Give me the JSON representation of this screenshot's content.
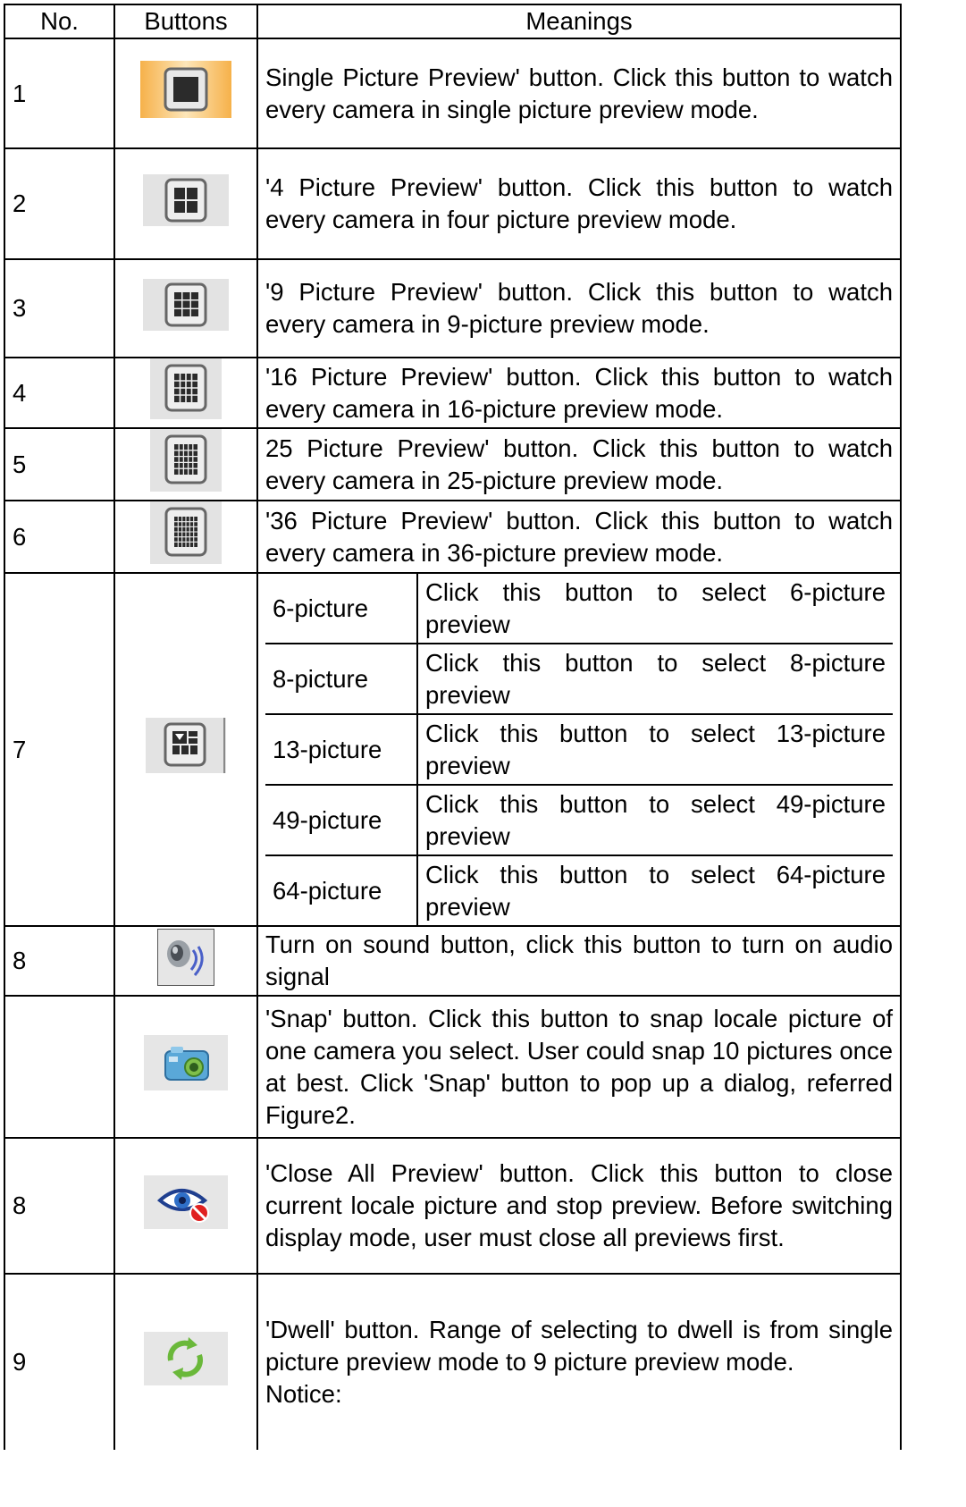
{
  "headers": {
    "no": "No.",
    "buttons": "Buttons",
    "meanings": "Meanings"
  },
  "rows": [
    {
      "no": "1",
      "icon": "single-picture-preview-icon",
      "meaning": "Single Picture Preview' button. Click this button to watch every camera in single picture preview mode."
    },
    {
      "no": "2",
      "icon": "four-picture-preview-icon",
      "meaning": "'4 Picture Preview' button. Click this button to watch every camera in four picture preview mode."
    },
    {
      "no": "3",
      "icon": "nine-picture-preview-icon",
      "meaning": "'9 Picture Preview' button. Click this button to watch every camera in 9-picture preview mode."
    },
    {
      "no": "4",
      "icon": "sixteen-picture-preview-icon",
      "meaning": "'16 Picture Preview' button. Click this button to watch every camera in 16-picture preview mode."
    },
    {
      "no": "5",
      "icon": "twentyfive-picture-preview-icon",
      "meaning": "25 Picture Preview' button. Click this button to watch every camera in 25-picture preview mode."
    },
    {
      "no": "6",
      "icon": "thirtysix-picture-preview-icon",
      "meaning": "'36 Picture Preview' button. Click this button to watch every camera in 36-picture preview mode."
    },
    {
      "no": "7",
      "icon": "multi-picture-dropdown-icon",
      "options": [
        {
          "label": "6-picture",
          "desc": "Click this button to select 6-picture preview"
        },
        {
          "label": "8-picture",
          "desc": "Click this button to select 8-picture preview"
        },
        {
          "label": "13-picture",
          "desc": "Click this button to select 13-picture preview"
        },
        {
          "label": "49-picture",
          "desc": "Click this button to select 49-picture preview"
        },
        {
          "label": "64-picture",
          "desc": "Click this button to select 64-picture preview"
        }
      ]
    },
    {
      "no": "8",
      "icon": "sound-icon",
      "meaning": "Turn on sound button, click this button to turn on audio signal"
    },
    {
      "no": "",
      "icon": "snap-camera-icon",
      "meaning": "'Snap' button. Click this button to snap locale picture of one camera you select. User could snap 10 pictures once at best. Click 'Snap' button to pop up a dialog, referred Figure2."
    },
    {
      "no": "8",
      "icon": "close-all-preview-icon",
      "meaning": "'Close All Preview' button. Click this button to close current locale picture and stop preview. Before switching display mode, user must close all previews first."
    },
    {
      "no": "9",
      "icon": "dwell-icon",
      "meaning": "'Dwell' button. Range of selecting to dwell is from single picture preview mode to 9 picture preview mode.",
      "notice": "Notice:"
    }
  ]
}
